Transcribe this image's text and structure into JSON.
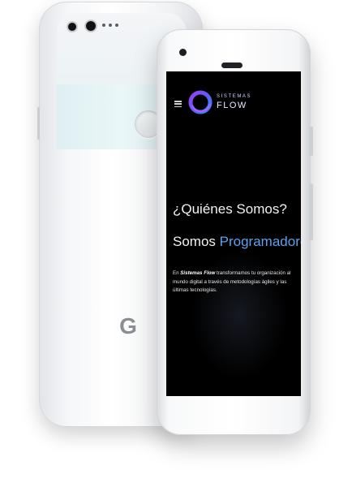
{
  "back_phone": {
    "brand_letter": "G",
    "icons": [
      "camera-icon",
      "flash-icon",
      "fingerprint-sensor-icon",
      "google-logo-icon"
    ]
  },
  "site": {
    "logo": {
      "top_text": "SISTEMAS",
      "bottom_text": "FLOW"
    },
    "menu_icon": "hamburger-menu-icon",
    "hero": {
      "title": "¿Quiénes Somos?",
      "subtitle_prefix": "Somos ",
      "subtitle_accent": "Programadores",
      "paragraph_lead": "En ",
      "paragraph_brand": "Sistemas Flow",
      "paragraph_body": " transformamos tu organización al mundo digital a través de metodologías ágiles y las últimas tecnologías."
    }
  },
  "colors": {
    "accent": "#5aa2ee",
    "screen_bg": "#000000",
    "logo_gradient": [
      "#7b3fe4",
      "#3b7dfc"
    ]
  }
}
